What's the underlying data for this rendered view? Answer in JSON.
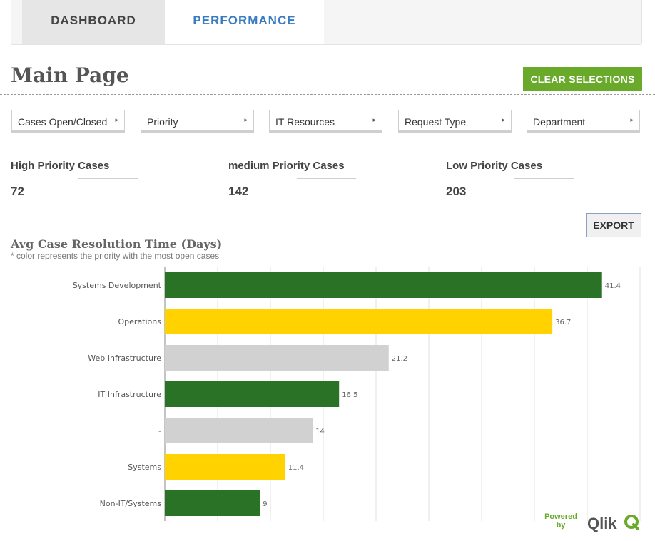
{
  "tabs": [
    {
      "label": "DASHBOARD"
    },
    {
      "label": "PERFORMANCE"
    }
  ],
  "page": {
    "title": "Main Page",
    "clear_label": "CLEAR SELECTIONS",
    "export_label": "EXPORT"
  },
  "filters": [
    {
      "label": "Cases Open/Closed"
    },
    {
      "label": "Priority"
    },
    {
      "label": "IT Resources"
    },
    {
      "label": "Request Type"
    },
    {
      "label": "Department"
    }
  ],
  "kpis": [
    {
      "label": "High Priority Cases",
      "value": "72"
    },
    {
      "label": "medium Priority Cases",
      "value": "142"
    },
    {
      "label": "Low Priority Cases",
      "value": "203"
    }
  ],
  "chart_data": {
    "type": "bar",
    "orientation": "horizontal",
    "title": "Avg Case Resolution Time (Days)",
    "subtitle": "* color represents the priority with the most open cases",
    "xlim": [
      0,
      45
    ],
    "grid": true,
    "categories": [
      "Systems Development",
      "Operations",
      "Web Infrastructure",
      "IT Infrastructure",
      "-",
      "Systems",
      "Non-IT/Systems"
    ],
    "values": [
      41.4,
      36.7,
      21.2,
      16.5,
      14,
      11.4,
      9
    ],
    "value_labels": [
      "41.4",
      "36.7",
      "21.2",
      "16.5",
      "14",
      "11.4",
      "9"
    ],
    "bar_colors": [
      "#2a7226",
      "#ffd200",
      "#d1d1d1",
      "#2a7226",
      "#d1d1d1",
      "#ffd200",
      "#2a7226"
    ]
  },
  "branding": {
    "powered_by": "Powered by",
    "logo_text": "Qlik",
    "logo_color": "#6aaa2b"
  },
  "colors": {
    "accent_green": "#6aaa2b",
    "tab_active_text": "#3a7cc1"
  },
  "icons": {
    "filter_expand": "▸"
  }
}
